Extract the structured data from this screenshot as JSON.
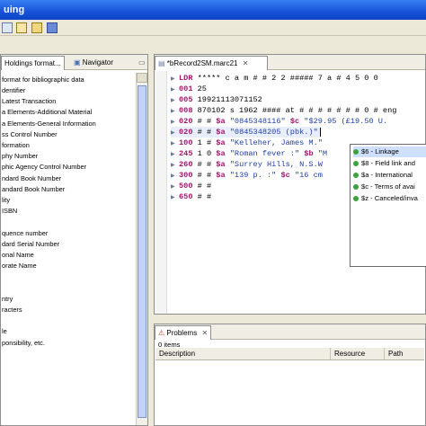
{
  "window": {
    "title": "uing"
  },
  "left_panel": {
    "tabs": [
      {
        "label": "Holdings format..."
      },
      {
        "label": "Navigator"
      }
    ],
    "close_glyph": "✕",
    "header": "format for bibliographic data",
    "rows": [
      "dentifier",
      "Latest Transaction",
      "a Elements-Additional Material",
      "a Elements-General Information",
      "ss Control Number",
      "formation",
      "phy Number",
      "phic Agency Control Number",
      "ndard Book Number",
      "andard Book Number",
      "lity",
      "ISBN",
      "",
      "quence number",
      "dard Serial Number",
      "onal Name",
      "orate Name",
      "",
      "",
      "ntry",
      "racters",
      "",
      "le",
      "ponsibility, etc.",
      ""
    ]
  },
  "editor": {
    "tab_label": "*bRecord2SM.marc21",
    "tab_close": "✕",
    "lines": [
      {
        "tag": "LDR",
        "content": " ***** c a m # # 2 2 ##### 7 a # 4 5 0 0"
      },
      {
        "tag": "001",
        "content": " 25"
      },
      {
        "tag": "005",
        "content": " 19921113071152"
      },
      {
        "tag": "008",
        "content": " 870102 s 1962 #### at # # # # # # # 0 # eng"
      },
      {
        "tag": "020",
        "ind": " # # ",
        "sub": "$a",
        "str": " \"0845348116\" ",
        "sub2": "$c",
        "str2": " \"$29.95 (£19.50 U."
      },
      {
        "tag": "020",
        "ind": " # # ",
        "sub": "$a",
        "str": " \"0845348205 (pbk.)\"",
        "cursor": true
      },
      {
        "tag": "100",
        "ind": " 1 # ",
        "sub": "$a",
        "str": " \"Kelleher, James M.\""
      },
      {
        "tag": "245",
        "ind": " 1 0 ",
        "sub": "$a",
        "str": " \"Roman fever :\" ",
        "sub2": "$b",
        "str2": " \"M"
      },
      {
        "tag": "260",
        "ind": " # # ",
        "sub": "$a",
        "str": " \"Surrey Hills, N.S.W"
      },
      {
        "tag": "300",
        "ind": " # # ",
        "sub": "$a",
        "str": " \"139 p. :\" ",
        "sub2": "$c",
        "str2": " \"16 cm"
      },
      {
        "tag": "500",
        "content": " # #"
      },
      {
        "tag": "650",
        "content": " # #"
      }
    ],
    "expand_glyph": "▶"
  },
  "autocomplete": {
    "items": [
      {
        "label": "$6 - Linkage"
      },
      {
        "label": "$8 - Field link and"
      },
      {
        "label": "$a - International"
      },
      {
        "label": "$c - Terms of avai"
      },
      {
        "label": "$z - Canceled/inva"
      }
    ]
  },
  "problems": {
    "tab_label": "Problems",
    "tab_close": "✕",
    "count": "0 items",
    "columns": [
      {
        "label": "Description"
      },
      {
        "label": "Resource"
      },
      {
        "label": "Path"
      }
    ]
  },
  "colors": {
    "accent": "#316ac5",
    "tag": "#a0156b",
    "string": "#1f3fa0"
  }
}
